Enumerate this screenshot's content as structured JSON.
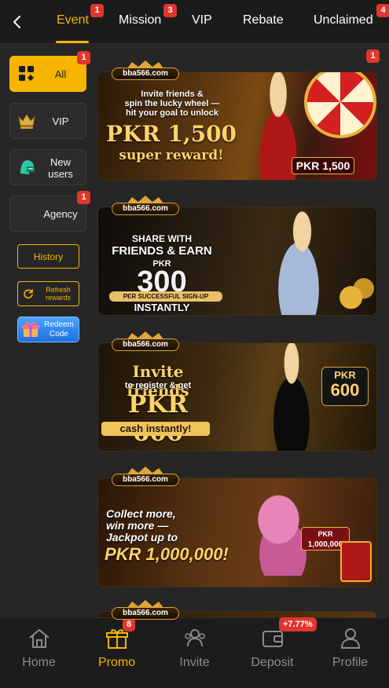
{
  "tabs": [
    {
      "label": "Event",
      "badge": "1",
      "active": true
    },
    {
      "label": "Mission",
      "badge": "3"
    },
    {
      "label": "VIP"
    },
    {
      "label": "Rebate"
    },
    {
      "label": "Unclaimed",
      "badge": "4"
    }
  ],
  "sidebar": {
    "items": [
      {
        "label": "All",
        "badge": "1",
        "icon": "grid-icon"
      },
      {
        "label": "VIP",
        "icon": "crown-icon"
      },
      {
        "label": "New users",
        "icon": "new-user-icon"
      },
      {
        "label": "Agency",
        "badge": "1"
      }
    ],
    "history": "History",
    "refresh": "Refresh rewards",
    "redeem": "Redeem Code"
  },
  "banners": [
    {
      "logo": "bba566.com",
      "badge": "1",
      "line1": "Invite friends &",
      "line2": "spin the lucky wheel —",
      "line3": "hit your goal to unlock",
      "amount": "PKR 1,500",
      "sub": "super reward!",
      "tag": "PKR 1,500"
    },
    {
      "logo": "bba566.com",
      "line1": "SHARE WITH",
      "line2": "FRIENDS & EARN",
      "currency": "PKR",
      "amount": "300",
      "sub": "PER SUCCESSFUL SIGN-UP",
      "sub2": "INSTANTLY"
    },
    {
      "logo": "bba566.com",
      "line1": "Invite friends",
      "line2": "to register & get",
      "amount": "PKR 600",
      "sub": "cash instantly!",
      "tag1": "PKR",
      "tag2": "600"
    },
    {
      "logo": "bba566.com",
      "line1": "Collect more,",
      "line2": "win more —",
      "line3": "Jackpot up to",
      "amount": "PKR 1,000,000!",
      "tag1": "PKR",
      "tag2": "1,000,000"
    },
    {
      "logo": "bba566.com"
    }
  ],
  "nav": [
    {
      "label": "Home",
      "icon": "home-icon"
    },
    {
      "label": "Promo",
      "icon": "gift-icon",
      "badge": "8",
      "active": true
    },
    {
      "label": "Invite",
      "icon": "invite-icon"
    },
    {
      "label": "Deposit",
      "icon": "wallet-icon",
      "badge": "+7.77%"
    },
    {
      "label": "Profile",
      "icon": "profile-icon"
    }
  ],
  "colors": {
    "accent": "#f5b400",
    "badge": "#e0362e",
    "background": "#262626"
  }
}
